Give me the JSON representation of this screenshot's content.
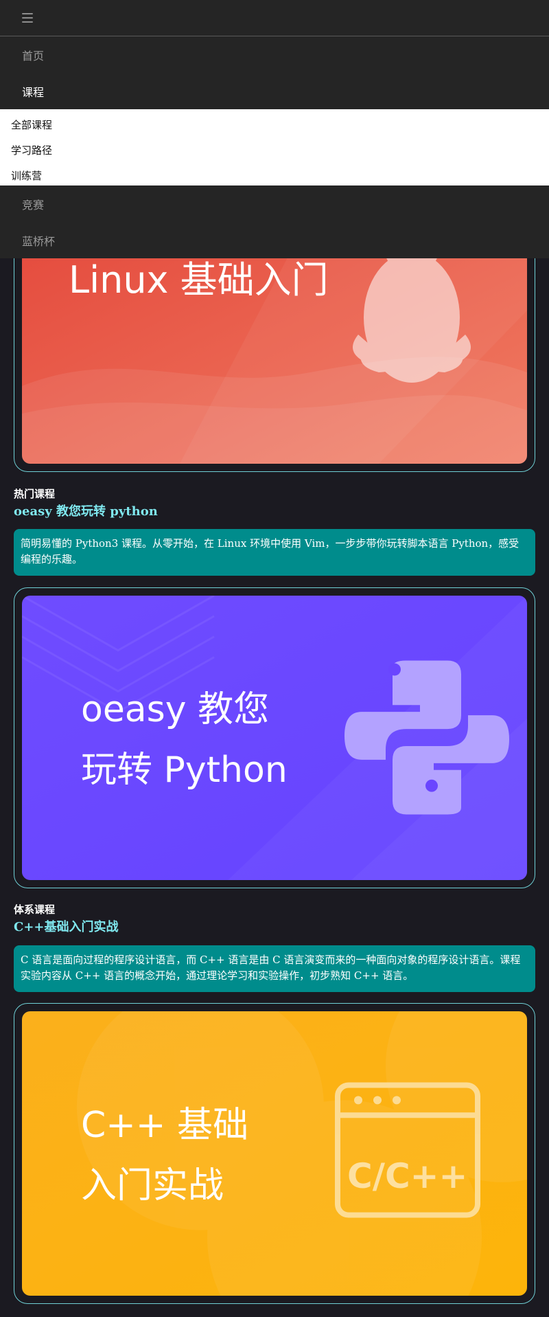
{
  "nav": {
    "items": [
      "首页",
      "课程"
    ],
    "dropdown": [
      "全部课程",
      "学习路径",
      "训练营"
    ],
    "items_after": [
      "竞赛",
      "蓝桥杯"
    ]
  },
  "courses": [
    {
      "banner_title_lines": [
        "Linux 基础入门"
      ],
      "banner_color": "#e8574a"
    },
    {
      "tag": "热门课程",
      "title": "oeasy 教您玩转 python",
      "description": "简明易懂的 Python3 课程。从零开始，在 Linux 环境中使用 Vim，一步步带你玩转脚本语言 Python，感受编程的乐趣。",
      "banner_title_lines": [
        "oeasy 教您",
        "玩转 Python"
      ],
      "banner_color": "#6a45ff"
    },
    {
      "tag": "体系课程",
      "title": "C++基础入门实战",
      "description": "C 语言是面向过程的程序设计语言，而 C++ 语言是由 C 语言演变而来的一种面向对象的程序设计语言。课程实验内容从 C++ 语言的概念开始，通过理论学习和实验操作，初步熟知 C++ 语言。",
      "banner_title_lines": [
        "C++ 基础",
        "入门实战"
      ],
      "banner_icon_text": "C/C++",
      "banner_color": "#fbb016"
    }
  ],
  "colors": {
    "accent": "#7fe7ee",
    "desc_bg": "#008c8c",
    "frame": "#6fd0d6",
    "page_bg": "#1b1a21"
  }
}
